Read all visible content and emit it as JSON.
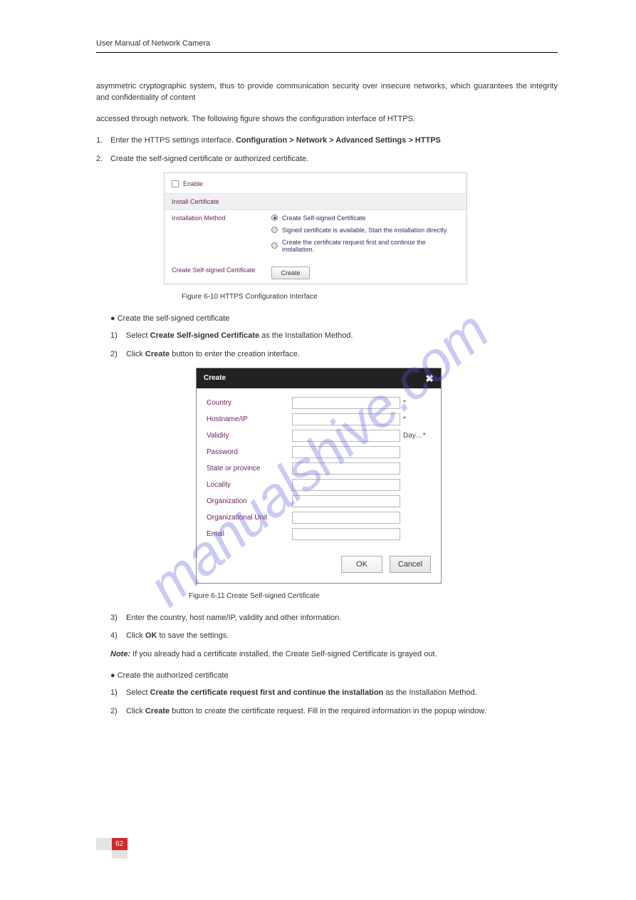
{
  "header": "User Manual of Network Camera",
  "intro_paragraphs": [
    "asymmetric cryptographic system, thus to provide communication security over insecure networks, which guarantees the integrity and confidentiality of content",
    "accessed through network. The following figure shows the configuration interface of HTTPS."
  ],
  "steps": {
    "s1_num": "1.",
    "s1_text_a": "Enter the HTTPS settings interface.",
    "s1_text_b": "Configuration > Network > Advanced Settings > HTTPS",
    "s2_num": "2.",
    "s2_text": "Create the self-signed certificate or authorized certificate."
  },
  "panel1": {
    "enable": "Enable",
    "section": "Install Certificate",
    "label_method": "Installation Method",
    "opt1": "Create Self-signed Certificate",
    "opt2": "Signed certificate is available, Start the installation directly.",
    "opt3": "Create the certificate request first and continue the installation.",
    "label_create": "Create Self-signed Certificate",
    "btn_create": "Create"
  },
  "fig1": "Figure 6-10 HTTPS Configuration Interface",
  "bullet_create": "Create the self-signed certificate",
  "sub1_num": "1)",
  "sub1_text": "Select Create Self-signed Certificate as the Installation Method.",
  "sub2_num": "2)",
  "sub2_text_a": "Click Create button to enter the creation interface.",
  "dialog": {
    "title": "Create",
    "fields": {
      "country": "Country",
      "hostname": "Hostname/IP",
      "validity": "Validity",
      "validity_unit": "Day…*",
      "password": "Password",
      "state": "State or province",
      "locality": "Locality",
      "org": "Organization",
      "ou": "Organizational Unit",
      "email": "Email"
    },
    "star": "*",
    "ok": "OK",
    "cancel": "Cancel"
  },
  "fig2": "Figure 6-11 Create Self-signed Certificate",
  "sub3_num": "3)",
  "sub3_text": "Enter the country, host name/IP, validity and other information.",
  "sub4_num": "4)",
  "sub4_text_a": "Click OK to save the settings.",
  "note_label": "Note:",
  "note_text": " If you already had a certificate installed, the Create Self-signed Certificate is grayed out.",
  "bullet_auth": "Create the authorized certificate",
  "asub1_num": "1)",
  "asub1_text": "Select Create the certificate request first and continue the installation as the Installation Method.",
  "asub2_num": "2)",
  "asub2_text": "Click Create button to create the certificate request. Fill in the required information in the popup window.",
  "pagenum": "62",
  "watermark": "manualshive.com"
}
